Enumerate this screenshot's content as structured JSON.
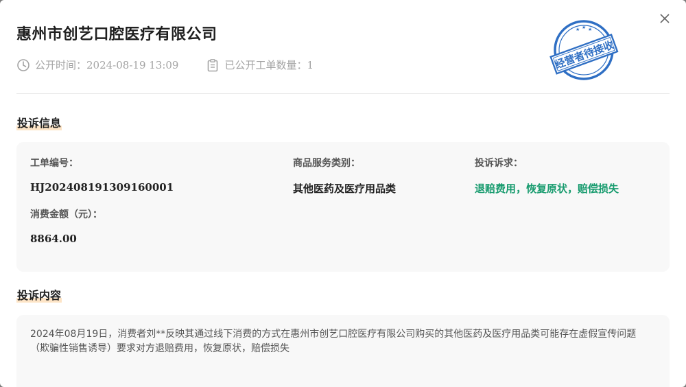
{
  "company": {
    "name": "惠州市创艺口腔医疗有限公司"
  },
  "meta": {
    "publish_time": "公开时间：2024-08-19 13:09",
    "ticket_count": "已公开工单数量：1"
  },
  "stamp": {
    "text": "经营者待接收",
    "color": "#2f6fc4"
  },
  "sections": {
    "complaint_info_title": "投诉信息",
    "complaint_content_title": "投诉内容"
  },
  "complaint_info": {
    "ticket_no_label": "工单编号：",
    "ticket_no_value": "HJ202408191309160001",
    "category_label": "商品服务类别：",
    "category_value": "其他医药及医疗用品类",
    "demand_label": "投诉诉求：",
    "demand_value": "退赔费用，恢复原状，赔偿损失",
    "amount_label": "消费金额（元）：",
    "amount_value": "8864.00"
  },
  "complaint_content": {
    "text": "2024年08月19日，消费者刘**反映其通过线下消费的方式在惠州市创艺口腔医疗有限公司购买的其他医药及医疗用品类可能存在虚假宣传问题（欺骗性销售诱导）要求对方退赔费用，恢复原状，赔偿损失"
  },
  "colors": {
    "accent_green": "#179b6e",
    "highlight": "#fde4c6"
  }
}
